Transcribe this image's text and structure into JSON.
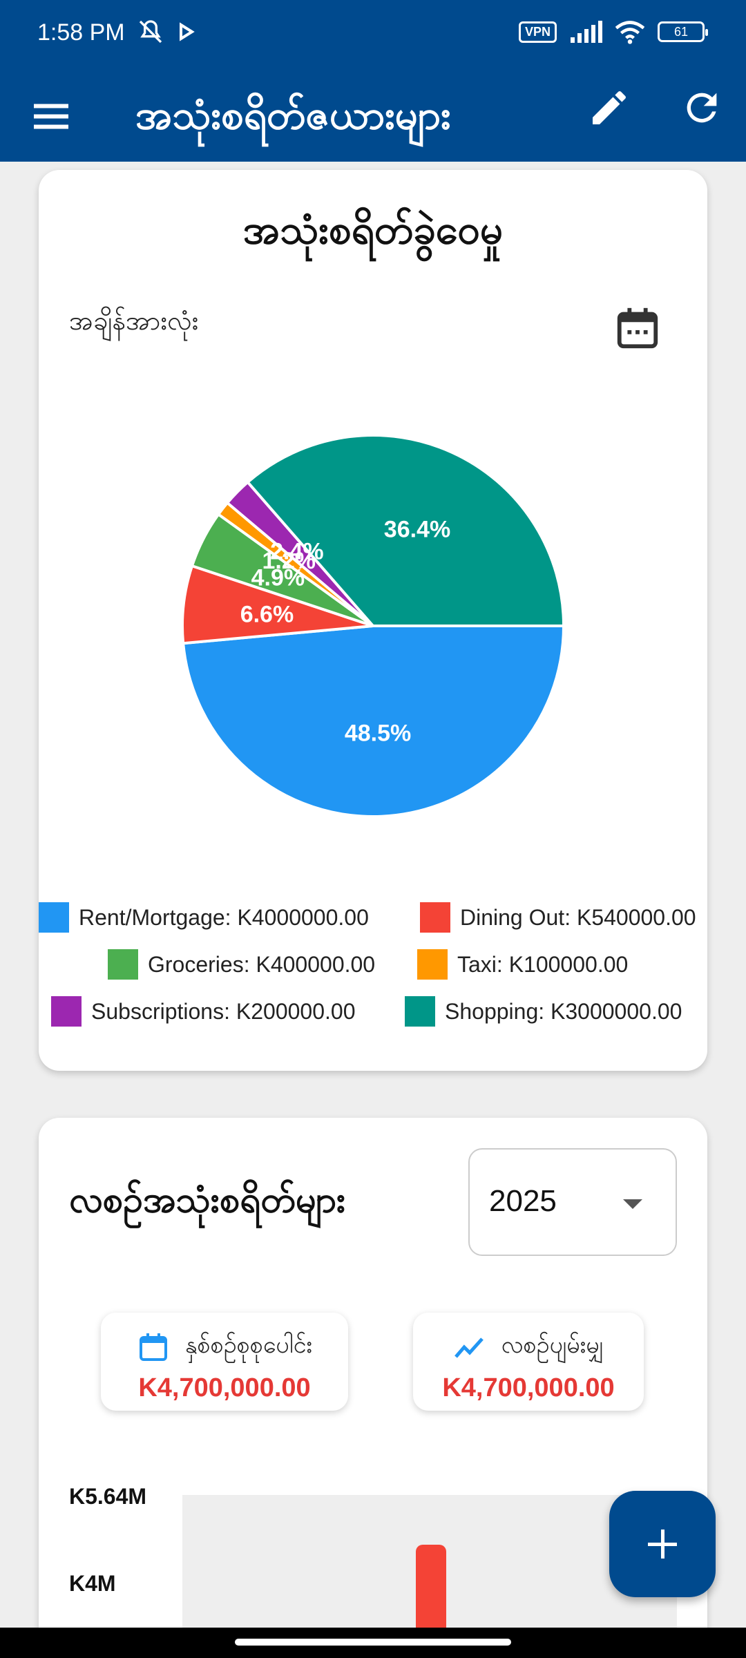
{
  "status_bar": {
    "time": "1:58 PM",
    "vpn": "VPN",
    "battery": "61",
    "icons": [
      "mute-icon",
      "play-icon",
      "signal-icon",
      "wifi-icon"
    ]
  },
  "app_bar": {
    "title": "အသုံးစရိတ်ဇယားများ",
    "icons": [
      "menu-icon",
      "edit-icon",
      "refresh-icon"
    ]
  },
  "expense_card": {
    "title": "အသုံးစရိတ်ခွဲဝေမှု",
    "filter_label": "အချိန်အားလုံး",
    "chart_data": {
      "type": "pie",
      "slices": [
        {
          "name": "Rent/Mortgage",
          "value": 4000000,
          "percent": 48.5,
          "label": "48.5%",
          "color": "#2196f3"
        },
        {
          "name": "Dining Out",
          "value": 540000,
          "percent": 6.6,
          "label": "6.6%",
          "color": "#f44336"
        },
        {
          "name": "Groceries",
          "value": 400000,
          "percent": 4.9,
          "label": "4.9%",
          "color": "#4caf50"
        },
        {
          "name": "Taxi",
          "value": 100000,
          "percent": 1.2,
          "label": "1.2%",
          "color": "#ff9800"
        },
        {
          "name": "Subscriptions",
          "value": 200000,
          "percent": 2.4,
          "label": "2.4%",
          "color": "#9c27b0"
        },
        {
          "name": "Shopping",
          "value": 3000000,
          "percent": 36.4,
          "label": "36.4%",
          "color": "#009688"
        }
      ]
    },
    "legend": [
      "Rent/Mortgage: K4000000.00",
      "Dining Out: K540000.00",
      "Groceries: K400000.00",
      "Taxi: K100000.00",
      "Subscriptions: K200000.00",
      "Shopping: K3000000.00"
    ]
  },
  "monthly_card": {
    "title": "လစဉ်အသုံးစရိတ်များ",
    "year_selected": "2025",
    "stats": [
      {
        "label": "နှစ်စဉ်စုစုပေါင်း",
        "value": "K4,700,000.00",
        "icon": "calendar-icon"
      },
      {
        "label": "လစဉ်ပျမ်းမျှ",
        "value": "K4,700,000.00",
        "icon": "trend-icon"
      }
    ],
    "y_axis_labels": [
      "K5.64M",
      "K4M"
    ],
    "accent_color": "#e53935"
  },
  "fab": {
    "icon": "plus-icon"
  }
}
